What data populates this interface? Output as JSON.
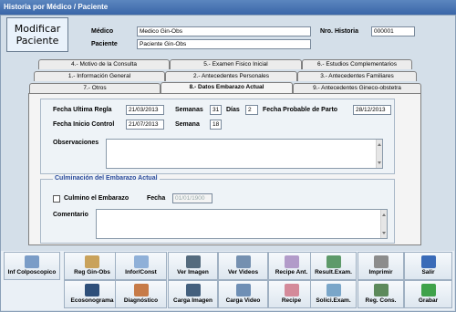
{
  "window": {
    "title": "Historia por Médico / Paciente"
  },
  "header": {
    "mode_label": "Modificar Paciente",
    "medico_label": "Médico",
    "medico_value": "Medico Gin-Obs",
    "paciente_label": "Paciente",
    "paciente_value": "Paciente Gin-Obs",
    "historia_label": "Nro. Historia",
    "historia_value": "000001"
  },
  "tabs": [
    {
      "label": "4.- Motivo de la Consulta"
    },
    {
      "label": "5.- Examen Fisico Inicial"
    },
    {
      "label": "6.- Estudios Complementarios"
    },
    {
      "label": "1.- Información General"
    },
    {
      "label": "2.- Antecedentes Personales"
    },
    {
      "label": "3.- Antecedentes Familiares"
    },
    {
      "label": "7.- Otros"
    },
    {
      "label": "8.- Datos Embarazo Actual"
    },
    {
      "label": "9.- Antecedentes Gineco-obstetra"
    }
  ],
  "form": {
    "fur_label": "Fecha Ultima Regla",
    "fur_value": "21/03/2013",
    "semanas_label": "Semanas",
    "semanas_value": "31",
    "dias_label": "Días",
    "dias_value": "2",
    "fpp_label": "Fecha Probable de Parto",
    "fpp_value": "28/12/2013",
    "fic_label": "Fecha Inicio Control",
    "fic_value": "21/07/2013",
    "semana_label": "Semana",
    "semana_value": "18",
    "obs_label": "Observaciones"
  },
  "culminacion": {
    "title": "Culminación del Embarazo Actual",
    "checkbox_label": "Culmino el Embarazo",
    "fecha_label": "Fecha",
    "fecha_value": "01/01/1900",
    "comentario_label": "Comentario"
  },
  "toolbar": {
    "row1": [
      "Inf Colposcopico",
      "Reg Gin-Obs",
      "Infor/Const",
      "Ver Imagen",
      "Ver Videos",
      "Recipe Ant.",
      "Result.Exam.",
      "Imprimir",
      "Salir"
    ],
    "row2": [
      "Ecosonograma",
      "Diagnóstico",
      "Carga Imagen",
      "Carga Video",
      "Recipe",
      "Solici.Exam.",
      "Reg. Cons.",
      "Grabar"
    ]
  },
  "colors": {
    "accent": "#3a66a8",
    "group_title": "#2a4a9a"
  }
}
